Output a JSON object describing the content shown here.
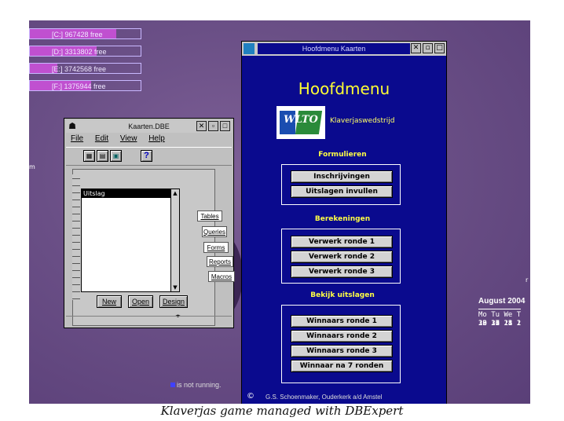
{
  "drives": [
    {
      "label": "[C:] 967428 free",
      "used_pct": 78
    },
    {
      "label": "[D:] 3313802 free",
      "used_pct": 60
    },
    {
      "label": "[E:] 3742568 free",
      "used_pct": 25
    },
    {
      "label": "[F:] 1375944 free",
      "used_pct": 55
    }
  ],
  "dbwindow": {
    "title": "Kaarten.DBE",
    "menu": [
      "File",
      "Edit",
      "View",
      "Help"
    ],
    "list_items": [
      "Uitslag"
    ],
    "tabs": [
      "Tables",
      "Queries",
      "Forms",
      "Reports",
      "Macros"
    ],
    "buttons": {
      "new": "New",
      "open": "Open",
      "design": "Design"
    }
  },
  "hoofdmenu": {
    "window_title": "Hoofdmenu Kaarten",
    "heading": "Hoofdmenu",
    "logo_text": "WLTO",
    "subtitle": "Klaverjaswedstrijd",
    "sections": [
      {
        "title": "Formulieren",
        "buttons": [
          "Inschrijvingen",
          "Uitslagen invullen"
        ]
      },
      {
        "title": "Berekeningen",
        "buttons": [
          "Verwerk ronde 1",
          "Verwerk ronde 2",
          "Verwerk ronde 3"
        ]
      },
      {
        "title": "Bekijk uitslagen",
        "buttons": [
          "Winnaars ronde 1",
          "Winnaars ronde 2",
          "Winnaars ronde 3",
          "Winnaar na 7 ronden"
        ]
      }
    ],
    "footer_symbol": "©",
    "footer": "G.S. Schoenmaker, Ouderkerk a/d Amstel"
  },
  "calendar": {
    "title": "August 2004",
    "weekdays": "Mo Tu We T",
    "rows": [
      " 2  3  4",
      " 9 10 11 1",
      "16 17 18 1",
      "23 24 25 2",
      "30 31"
    ]
  },
  "desktop_letter_left": "m",
  "desktop_letter_right": "r",
  "status_text": "is not running.",
  "caption": "Klaverjas game managed with DBExpert",
  "colors": {
    "hoofdmenu_bg": "#0a0a8e",
    "heading": "#ffff33",
    "desktop": "#6a4f86"
  }
}
